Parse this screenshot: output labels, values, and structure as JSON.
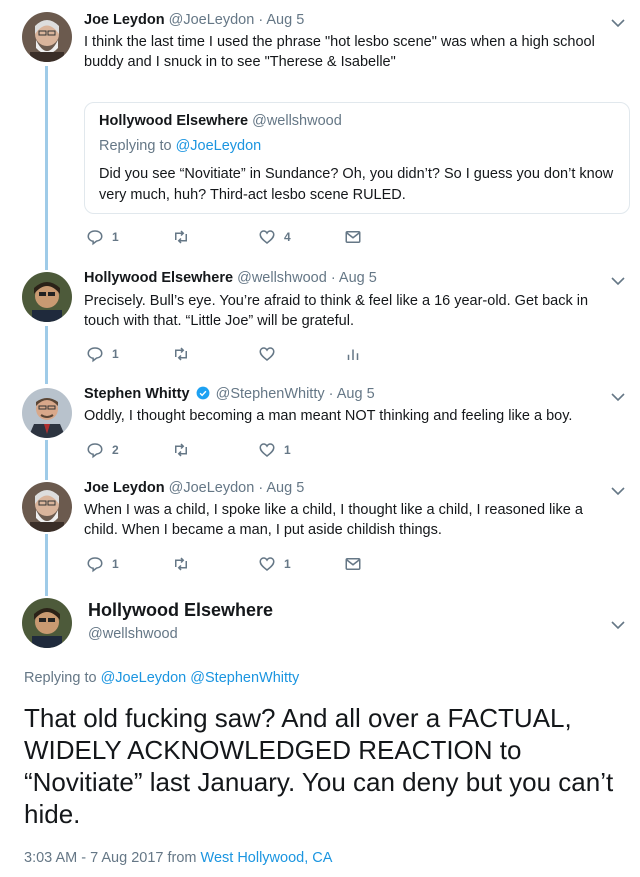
{
  "tweets": [
    {
      "name": "Joe Leydon",
      "handle": "@JoeLeydon",
      "separator": "·",
      "date": "Aug 5",
      "text": "I think the last time I used the phrase \"hot lesbo scene\" was when a high school buddy and I snuck in to see \"Therese & Isabelle\"",
      "quote": {
        "name": "Hollywood Elsewhere",
        "handle": "@wellshwood",
        "replying_prefix": "Replying to",
        "replying_to": "@JoeLeydon",
        "text": "Did you see “Novitiate” in Sundance? Oh, you didn’t? So I guess you don’t know very much, huh? Third-act lesbo scene RULED."
      },
      "replies": "1",
      "retweets": "",
      "likes": "4"
    },
    {
      "name": "Hollywood Elsewhere",
      "handle": "@wellshwood",
      "separator": "·",
      "date": "Aug 5",
      "text": "Precisely. Bull’s eye. You’re afraid to think & feel like a 16 year-old. Get back in touch with that. “Little Joe” will be grateful.",
      "replies": "1",
      "retweets": "",
      "likes": ""
    },
    {
      "name": "Stephen Whitty",
      "handle": "@StephenWhitty",
      "separator": "·",
      "date": "Aug 5",
      "text": "Oddly, I thought becoming a man meant NOT thinking and feeling like a boy.",
      "replies": "2",
      "retweets": "",
      "likes": "1"
    },
    {
      "name": "Joe Leydon",
      "handle": "@JoeLeydon",
      "separator": "·",
      "date": "Aug 5",
      "text": "When I was a child, I spoke like a child, I thought like a child, I reasoned like a child. When I became a man, I put aside childish things.",
      "replies": "1",
      "retweets": "",
      "likes": "1"
    }
  ],
  "main": {
    "name": "Hollywood Elsewhere",
    "handle": "@wellshwood",
    "replying_prefix": "Replying to",
    "replying_to_1": "@JoeLeydon",
    "replying_to_2": "@StephenWhitty",
    "text": "That old fucking saw? And all over a FACTUAL, WIDELY ACKNOWLEDGED REACTION to “Novitiate” last January. You can deny but you can’t hide.",
    "timestamp": "3:03 AM - 7 Aug 2017",
    "from_label": "from",
    "location": "West Hollywood, CA"
  },
  "colors": {
    "link": "#1b95e0",
    "thread_line": "#9fcbe8",
    "icon": "#657786",
    "verified": "#1da1f2"
  }
}
